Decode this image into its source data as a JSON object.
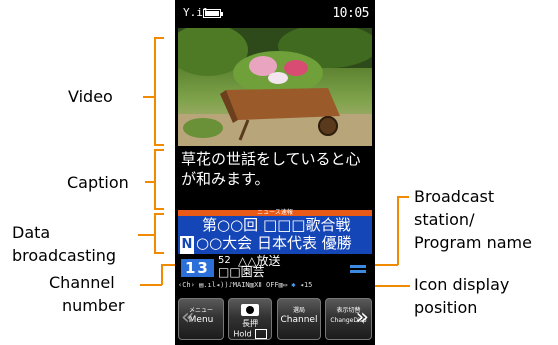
{
  "callouts": {
    "video": "Video",
    "caption": "Caption",
    "data_broadcasting_1": "Data",
    "data_broadcasting_2": "broadcasting",
    "channel_number_1": "Channel",
    "channel_number_2": "number",
    "broadcast_station_1": "Broadcast",
    "broadcast_station_2": "station/",
    "broadcast_station_3": "Program name",
    "icon_display_1": "Icon display",
    "icon_display_2": "position"
  },
  "status_bar": {
    "signal": "Y.il",
    "time": "10:05"
  },
  "caption": {
    "text": "草花の世話をしていると心が和みます。"
  },
  "data_broadcasting": {
    "header": "ニュース速報",
    "row1": "第○○回 □□□歌合戦",
    "badge": "N",
    "row2": "○○大会 日本代表 優勝"
  },
  "channel": {
    "number": "13",
    "sub_number": "52",
    "station": "△△放送",
    "program": "□□園芸"
  },
  "icon_row": {
    "text": "‹Ch› ▤.ıl◂))♪MAIN▥Ⅻ OFF▥▭",
    "bluetooth": "✱",
    "volume": "◂15"
  },
  "softkeys": {
    "menu_small": "メニュー",
    "menu_label": "Menu",
    "cam_small": "長押",
    "cam_label": "Hold",
    "channel_small": "選局",
    "channel_label": "Channel",
    "change_small": "表示切替",
    "change_label": "ChangeDisp"
  },
  "colors": {
    "callout_line": "#f08a00",
    "data_broadcast_bg": "#1546b8",
    "channel_badge": "#2d6fd8"
  }
}
